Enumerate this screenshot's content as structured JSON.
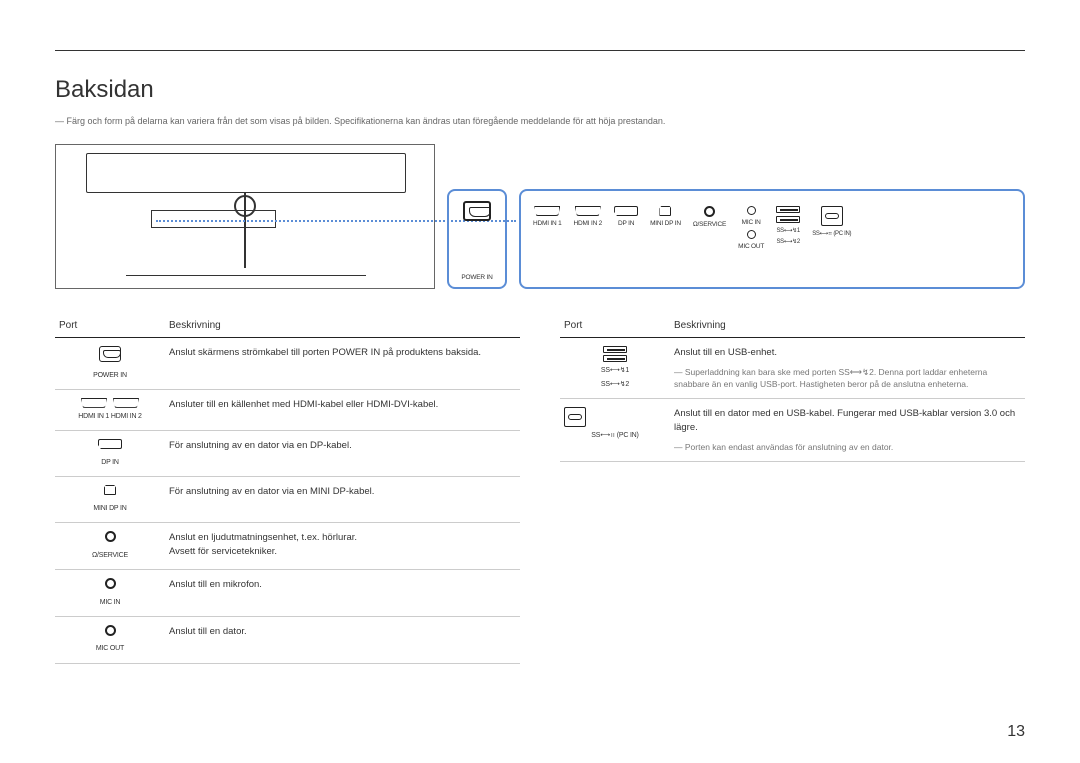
{
  "title": "Baksidan",
  "top_note": "Färg och form på delarna kan variera från det som visas på bilden. Specifikationerna kan ändras utan föregående meddelande för att höja prestandan.",
  "callout_power_label": "POWER IN",
  "callout_ports": {
    "hdmi1": "HDMI IN 1",
    "hdmi2": "HDMI IN 2",
    "dp": "DP IN",
    "mdp": "MINI DP IN",
    "service": "/SERVICE",
    "mic_in": "MIC IN",
    "mic_out": "MIC OUT",
    "ss1": "SS⟷↯1",
    "ss2": "SS⟷↯2",
    "pcin": "SS⟷⠶ (PC IN)"
  },
  "headers": {
    "port": "Port",
    "desc": "Beskrivning"
  },
  "left_rows": [
    {
      "label": "POWER IN",
      "desc": "Anslut skärmens strömkabel till porten POWER IN på produktens baksida."
    },
    {
      "label": "HDMI IN 1    HDMI IN 2",
      "desc": "Ansluter till en källenhet med HDMI-kabel eller HDMI-DVI-kabel."
    },
    {
      "label": "DP IN",
      "desc": "För anslutning av en dator via en DP-kabel."
    },
    {
      "label": "MINI DP IN",
      "desc": "För anslutning av en dator via en MINI DP-kabel."
    },
    {
      "label": "/SERVICE",
      "desc_a": "Anslut en ljudutmatningsenhet, t.ex. hörlurar.",
      "desc_b": "Avsett för servicetekniker."
    },
    {
      "label": "MIC IN",
      "desc": "Anslut till en mikrofon."
    },
    {
      "label": "MIC OUT",
      "desc": "Anslut till en dator."
    }
  ],
  "right_rows": [
    {
      "label_a": "SS⟷↯1",
      "label_b": "SS⟷↯2",
      "desc": "Anslut till en USB-enhet.",
      "note": "Superladdning kan bara ske med porten SS⟷↯2. Denna port laddar enheterna snabbare än en vanlig USB-port. Hastigheten beror på de anslutna enheterna."
    },
    {
      "label": "SS⟷⠶ (PC IN)",
      "desc": "Anslut till en dator med en USB-kabel. Fungerar med USB-kablar version 3.0 och lägre.",
      "note": "Porten kan endast användas för anslutning av en dator."
    }
  ],
  "page_number": "13"
}
